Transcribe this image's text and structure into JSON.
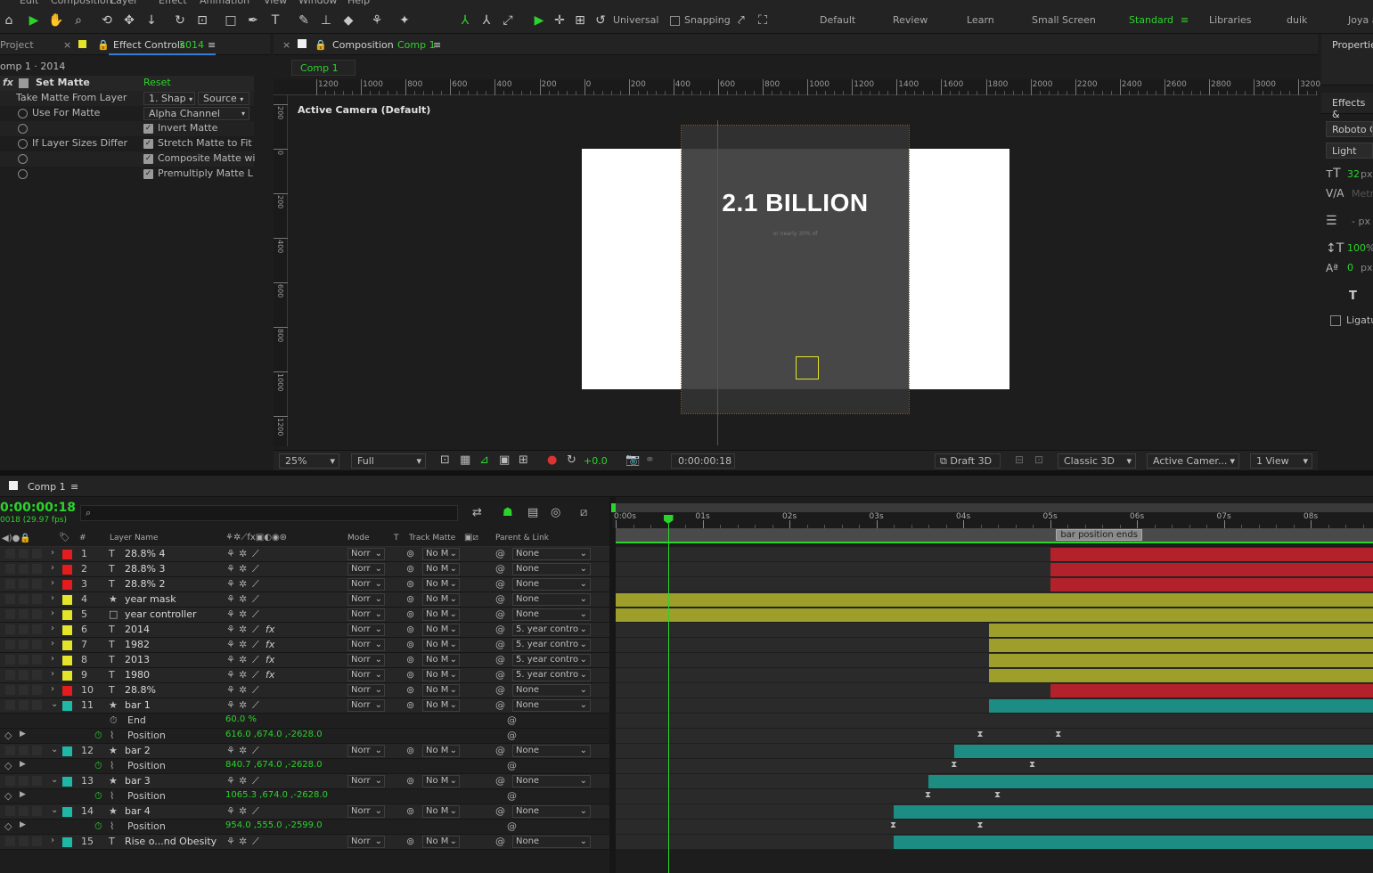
{
  "menu": [
    "Edit",
    "Composition",
    "Layer",
    "Effect",
    "Animation",
    "View",
    "Window",
    "Help"
  ],
  "toolbar": {
    "universal_label": "Universal",
    "snapping_label": "Snapping",
    "workspaces": [
      "Default",
      "Review",
      "Learn",
      "Small Screen",
      "Standard",
      "Libraries",
      "duik",
      "Joya a"
    ],
    "active_workspace": "Standard"
  },
  "left_panel": {
    "project_tab": "Project",
    "effect_controls_tab": "Effect Controls",
    "effect_controls_layer": "2014",
    "breadcrumb": "omp 1 · 2014",
    "effect_name": "Set Matte",
    "reset_label": "Reset",
    "rows": [
      {
        "label": "Take Matte From Layer",
        "value": "1. Shap",
        "value2": "Source"
      },
      {
        "label": "Use For Matte",
        "value": "Alpha Channel"
      },
      {
        "label": "",
        "check": "Invert Matte"
      },
      {
        "label": "If Layer Sizes Differ",
        "check": "Stretch Matte to Fit"
      },
      {
        "label": "",
        "check": "Composite Matte wi"
      },
      {
        "label": "",
        "check": "Premultiply Matte L"
      }
    ]
  },
  "composition": {
    "tab_label": "Composition",
    "tab_comp": "Comp 1",
    "comp_chip": "Comp 1",
    "ruler_labels": [
      "1200",
      "1000",
      "800",
      "600",
      "400",
      "200",
      "0",
      "200",
      "400",
      "600",
      "800",
      "1000",
      "1200",
      "1400",
      "1600",
      "1800",
      "2000",
      "2200",
      "2400",
      "2600",
      "2800",
      "3000",
      "3200"
    ],
    "vruler_labels": [
      "200",
      "0",
      "200",
      "400",
      "600",
      "800",
      "1000",
      "1200"
    ],
    "camera_label": "Active Camera (Default)",
    "headline": "2.1 BILLION",
    "subtext": "or nearly 30% of",
    "zoom": "25%",
    "resolution": "Full",
    "exposure": "+0.0",
    "timecode": "0:00:00:18",
    "draft3d": "Draft 3D",
    "renderer": "Classic 3D",
    "camera_select": "Active Camer...",
    "view_select": "1 View"
  },
  "right_panel": {
    "properties": "Properties",
    "effects": "Effects &",
    "font": "Roboto C",
    "style": "Light",
    "font_size": "32",
    "px": "px",
    "tracking_label": "Metric",
    "leading": "- px",
    "vscale": "100",
    "baseline": "0",
    "ligatures": "Ligatu"
  },
  "timeline": {
    "tab_label": "Comp 1",
    "timecode": "0:00:00:18",
    "frames": "0018 (29.97 fps)",
    "search_placeholder": "",
    "col_layer_name": "Layer Name",
    "col_mode": "Mode",
    "col_t": "T",
    "col_track_matte": "Track Matte",
    "col_parent": "Parent & Link",
    "ticks": [
      "0:00s",
      "01s",
      "02s",
      "03s",
      "04s",
      "05s",
      "06s",
      "07s",
      "08s"
    ],
    "marker": "bar position ends",
    "layers": [
      {
        "num": "1",
        "type": "T",
        "name": "28.8% 4",
        "color": "#e31d1d",
        "mode": "Norr",
        "matte": "No M",
        "parent": "None",
        "fx": false,
        "bar": {
          "start": 5.0,
          "end": 9,
          "color": "#b3222a"
        }
      },
      {
        "num": "2",
        "type": "T",
        "name": "28.8% 3",
        "color": "#e31d1d",
        "mode": "Norr",
        "matte": "No M",
        "parent": "None",
        "fx": false,
        "bar": {
          "start": 5.0,
          "end": 9,
          "color": "#b3222a"
        }
      },
      {
        "num": "3",
        "type": "T",
        "name": "28.8% 2",
        "color": "#e31d1d",
        "mode": "Norr",
        "matte": "No M",
        "parent": "None",
        "fx": false,
        "bar": {
          "start": 5.0,
          "end": 9,
          "color": "#b3222a"
        }
      },
      {
        "num": "4",
        "type": "★",
        "name": "year mask",
        "color": "#e4e42a",
        "mode": "Norr",
        "matte": "No M",
        "parent": "None",
        "fx": false,
        "bar": {
          "start": 0,
          "end": 9,
          "color": "#9e9e2a"
        }
      },
      {
        "num": "5",
        "type": "□",
        "name": "year controller",
        "color": "#e4e42a",
        "mode": "Norr",
        "matte": "No M",
        "parent": "None",
        "fx": false,
        "bar": {
          "start": 0,
          "end": 9,
          "color": "#9e9e2a"
        }
      },
      {
        "num": "6",
        "type": "T",
        "name": "2014",
        "color": "#e4e42a",
        "mode": "Norr",
        "matte": "No M",
        "parent": "5. year contro",
        "fx": true,
        "bar": {
          "start": 4.3,
          "end": 9,
          "color": "#9e9e2a"
        }
      },
      {
        "num": "7",
        "type": "T",
        "name": "1982",
        "color": "#e4e42a",
        "mode": "Norr",
        "matte": "No M",
        "parent": "5. year contro",
        "fx": true,
        "bar": {
          "start": 4.3,
          "end": 9,
          "color": "#9e9e2a"
        }
      },
      {
        "num": "8",
        "type": "T",
        "name": "2013",
        "color": "#e4e42a",
        "mode": "Norr",
        "matte": "No M",
        "parent": "5. year contro",
        "fx": true,
        "bar": {
          "start": 4.3,
          "end": 9,
          "color": "#9e9e2a"
        }
      },
      {
        "num": "9",
        "type": "T",
        "name": "1980",
        "color": "#e4e42a",
        "mode": "Norr",
        "matte": "No M",
        "parent": "5. year contro",
        "fx": true,
        "bar": {
          "start": 4.3,
          "end": 9,
          "color": "#9e9e2a"
        }
      },
      {
        "num": "10",
        "type": "T",
        "name": "28.8%",
        "color": "#e31d1d",
        "mode": "Norr",
        "matte": "No M",
        "parent": "None",
        "fx": false,
        "bar": {
          "start": 5.0,
          "end": 9,
          "color": "#b3222a"
        }
      },
      {
        "num": "11",
        "type": "★",
        "name": "bar 1",
        "color": "#1fb8a6",
        "mode": "Norr",
        "matte": "No M",
        "parent": "None",
        "fx": false,
        "bar": {
          "start": 4.3,
          "end": 9,
          "color": "#1d8c82"
        }
      },
      {
        "prop": true,
        "name": "End",
        "value": "60.0 %"
      },
      {
        "prop": true,
        "kf": true,
        "name": "Position",
        "value": "616.0 ,674.0 ,-2628.0",
        "keys": [
          4.2,
          5.1
        ]
      },
      {
        "num": "12",
        "type": "★",
        "name": "bar 2",
        "color": "#1fb8a6",
        "mode": "Norr",
        "matte": "No M",
        "parent": "None",
        "fx": false,
        "bar": {
          "start": 3.9,
          "end": 9,
          "color": "#1d8c82"
        }
      },
      {
        "prop": true,
        "kf": true,
        "name": "Position",
        "value": "840.7 ,674.0 ,-2628.0",
        "keys": [
          3.9,
          4.8
        ]
      },
      {
        "num": "13",
        "type": "★",
        "name": "bar 3",
        "color": "#1fb8a6",
        "mode": "Norr",
        "matte": "No M",
        "parent": "None",
        "fx": false,
        "bar": {
          "start": 3.6,
          "end": 9,
          "color": "#1d8c82"
        }
      },
      {
        "prop": true,
        "kf": true,
        "name": "Position",
        "value": "1065.3 ,674.0 ,-2628.0",
        "keys": [
          3.6,
          4.4
        ]
      },
      {
        "num": "14",
        "type": "★",
        "name": "bar 4",
        "color": "#1fb8a6",
        "mode": "Norr",
        "matte": "No M",
        "parent": "None",
        "fx": false,
        "bar": {
          "start": 3.2,
          "end": 9,
          "color": "#1d8c82"
        }
      },
      {
        "prop": true,
        "kf": true,
        "name": "Position",
        "value": "954.0 ,555.0 ,-2599.0",
        "keys": [
          3.2,
          4.2
        ]
      },
      {
        "num": "15",
        "type": "T",
        "name": "Rise o...nd Obesity",
        "color": "#1fb8a6",
        "mode": "Norr",
        "matte": "No M",
        "parent": "None",
        "fx": false,
        "bar": {
          "start": 3.2,
          "end": 9,
          "color": "#1d8c82"
        }
      }
    ]
  }
}
